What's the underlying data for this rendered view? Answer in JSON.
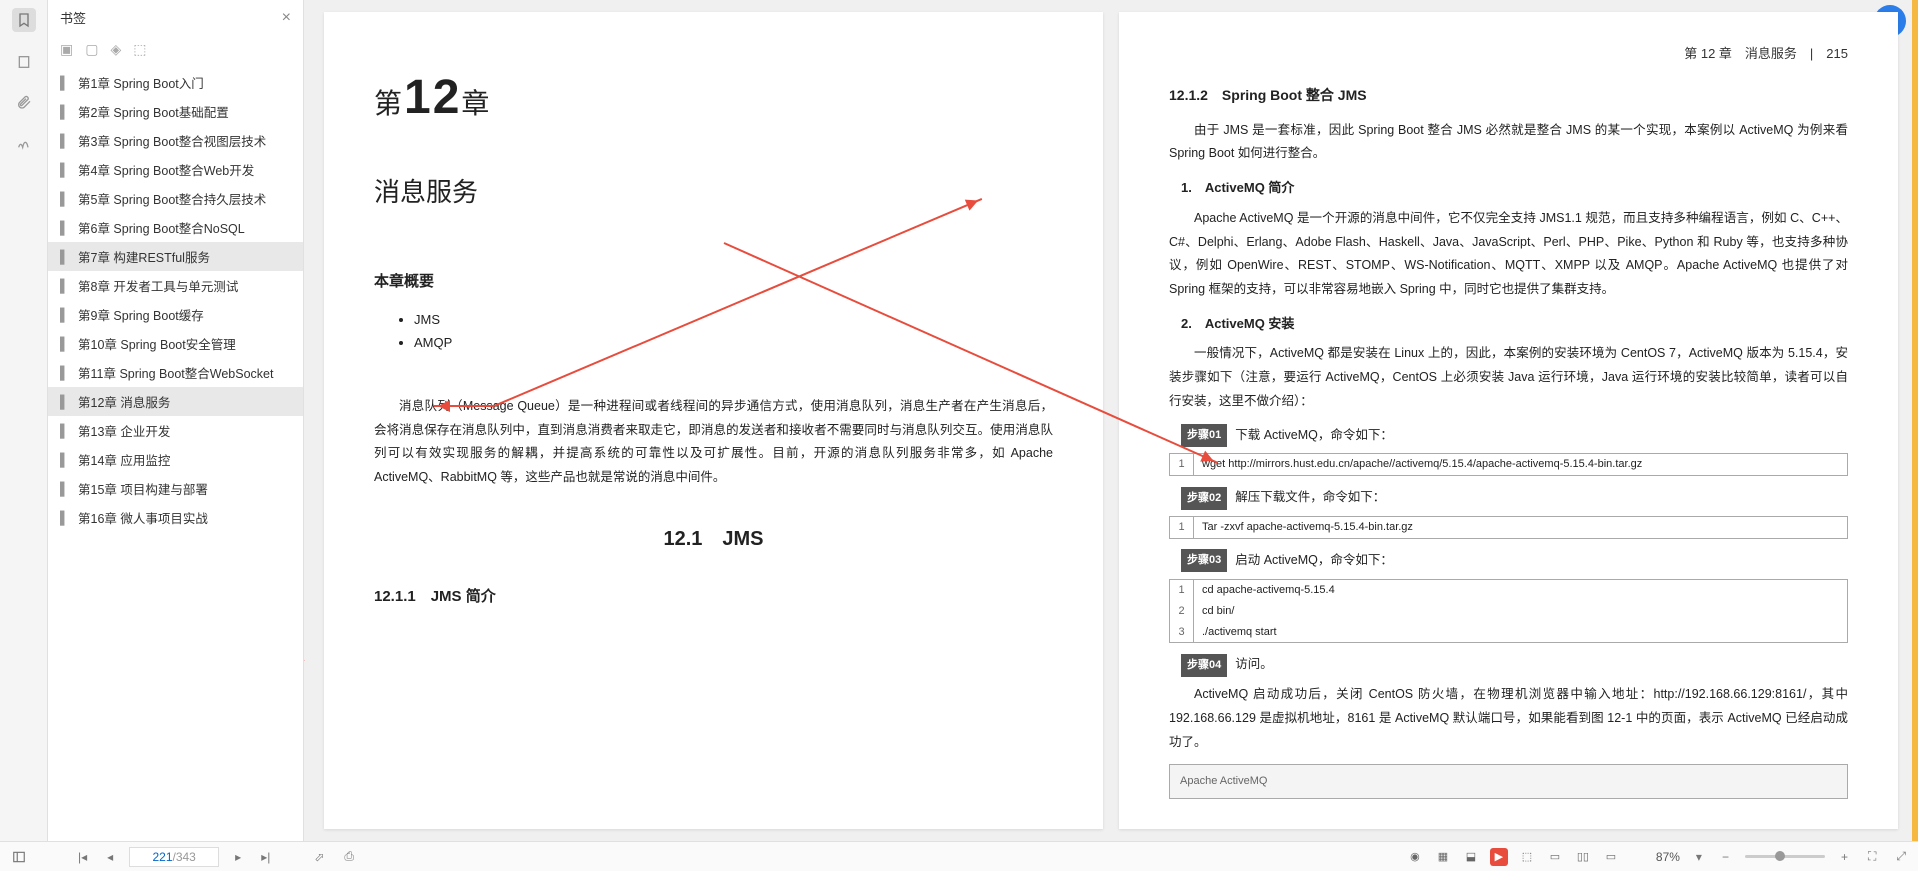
{
  "sidebar": {
    "title": "书签",
    "items": [
      {
        "label": "第1章 Spring Boot入门"
      },
      {
        "label": "第2章 Spring Boot基础配置"
      },
      {
        "label": "第3章 Spring Boot整合视图层技术"
      },
      {
        "label": "第4章 Spring Boot整合Web开发"
      },
      {
        "label": "第5章 Spring Boot整合持久层技术"
      },
      {
        "label": "第6章 Spring Boot整合NoSQL"
      },
      {
        "label": "第7章 构建RESTful服务"
      },
      {
        "label": "第8章 开发者工具与单元测试"
      },
      {
        "label": "第9章 Spring Boot缓存"
      },
      {
        "label": "第10章 Spring Boot安全管理"
      },
      {
        "label": "第11章 Spring Boot整合WebSocket"
      },
      {
        "label": "第12章 消息服务"
      },
      {
        "label": "第13章 企业开发"
      },
      {
        "label": "第14章 应用监控"
      },
      {
        "label": "第15章 项目构建与部署"
      },
      {
        "label": "第16章 微人事项目实战"
      }
    ],
    "highlighted": [
      6,
      11
    ]
  },
  "left_page": {
    "chapter_prefix": "第",
    "chapter_num": "12",
    "chapter_suffix": "章",
    "chapter_title": "消息服务",
    "toc_heading": "本章概要",
    "toc": [
      "JMS",
      "AMQP"
    ],
    "intro": "消息队列（Message Queue）是一种进程间或者线程间的异步通信方式，使用消息队列，消息生产者在产生消息后，会将消息保存在消息队列中，直到消息消费者来取走它，即消息的发送者和接收者不需要同时与消息队列交互。使用消息队列可以有效实现服务的解耦，并提高系统的可靠性以及可扩展性。目前，开源的消息队列服务非常多，如 Apache ActiveMQ、RabbitMQ 等，这些产品也就是常说的消息中间件。",
    "sec_12_1": "12.1　JMS",
    "sec_12_1_1": "12.1.1　JMS 简介"
  },
  "right_page": {
    "header": "第 12 章　消息服务　|　215",
    "sec_12_1_2": "12.1.2　Spring Boot 整合 JMS",
    "p1": "由于 JMS 是一套标准，因此 Spring Boot 整合 JMS 必然就是整合 JMS 的某一个实现，本案例以 ActiveMQ 为例来看 Spring Boot 如何进行整合。",
    "h_1": "1.　ActiveMQ 简介",
    "p2": "Apache ActiveMQ 是一个开源的消息中间件，它不仅完全支持 JMS1.1 规范，而且支持多种编程语言，例如 C、C++、C#、Delphi、Erlang、Adobe Flash、Haskell、Java、JavaScript、Perl、PHP、Pike、Python 和 Ruby 等，也支持多种协议，例如 OpenWire、REST、STOMP、WS-Notification、MQTT、XMPP 以及 AMQP。Apache ActiveMQ 也提供了对 Spring 框架的支持，可以非常容易地嵌入 Spring 中，同时它也提供了集群支持。",
    "h_2": "2.　ActiveMQ 安装",
    "p3": "一般情况下，ActiveMQ 都是安装在 Linux 上的，因此，本案例的安装环境为 CentOS 7，ActiveMQ 版本为 5.15.4，安装步骤如下（注意，要运行 ActiveMQ，CentOS 上必须安装 Java 运行环境，Java 运行环境的安装比较简单，读者可以自行安装，这里不做介绍）：",
    "steps": [
      {
        "n": "01",
        "txt": "下载 ActiveMQ，命令如下：",
        "code": [
          "wget http://mirrors.hust.edu.cn/apache//activemq/5.15.4/apache-activemq-5.15.4-bin.tar.gz"
        ]
      },
      {
        "n": "02",
        "txt": "解压下载文件，命令如下：",
        "code": [
          "Tar -zxvf apache-activemq-5.15.4-bin.tar.gz"
        ]
      },
      {
        "n": "03",
        "txt": "启动 ActiveMQ，命令如下：",
        "code": [
          "cd apache-activemq-5.15.4",
          "cd bin/",
          "./activemq start"
        ]
      },
      {
        "n": "04",
        "txt": "访问。"
      }
    ],
    "step_label": "步骤",
    "p4": "ActiveMQ 启动成功后，关闭 CentOS 防火墙，在物理机浏览器中输入地址：http://192.168.66.129:8161/，其中 192.168.66.129 是虚拟机地址，8161 是 ActiveMQ 默认端口号，如果能看到图 12-1 中的页面，表示 ActiveMQ 已经启动成功了。",
    "mini_browser": "Apache ActiveMQ"
  },
  "footer": {
    "current_page": "221",
    "total_pages": "/343",
    "zoom": "87%"
  }
}
